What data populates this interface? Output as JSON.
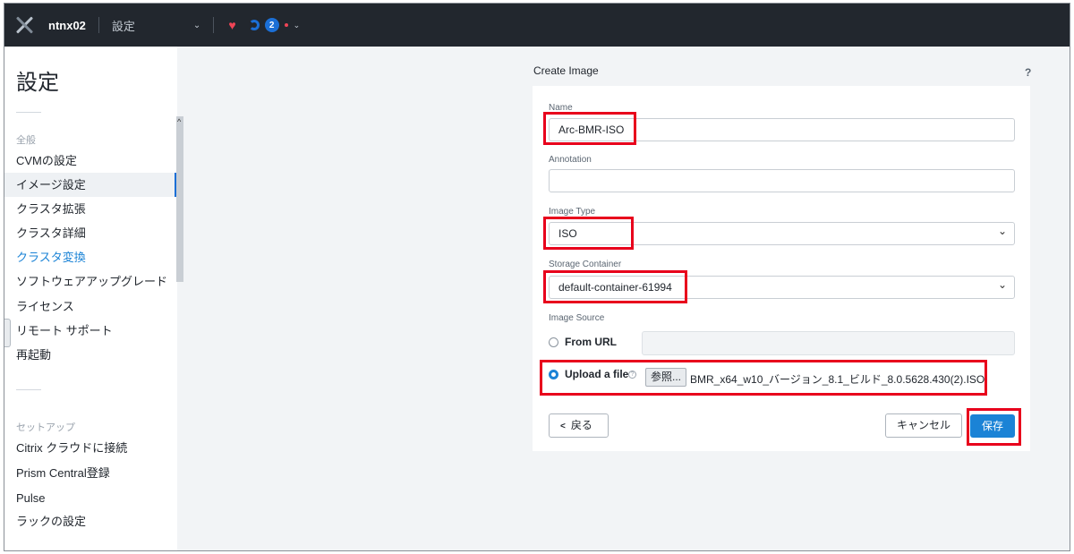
{
  "topbar": {
    "cluster_name": "ntnx02",
    "breadcrumb": "設定",
    "dropdown_icon": "chevron-down-icon",
    "notification_count": "2",
    "health_color": "#f04456",
    "accent_color": "#1b6fd6"
  },
  "sidebar": {
    "title": "設定",
    "section_general": "全般",
    "general_items": [
      {
        "label": "CVMの設定"
      },
      {
        "label": "イメージ設定"
      },
      {
        "label": "クラスタ拡張"
      },
      {
        "label": "クラスタ詳細"
      },
      {
        "label": "クラスタ変換"
      },
      {
        "label": "ソフトウェアアップグレード"
      },
      {
        "label": "ライセンス"
      },
      {
        "label": "リモート サポート"
      },
      {
        "label": "再起動"
      }
    ],
    "section_setup": "セットアップ",
    "setup_items": [
      {
        "label": "Citrix クラウドに接続"
      },
      {
        "label": "Prism Central登録"
      },
      {
        "label": "Pulse"
      },
      {
        "label": "ラックの設定"
      }
    ]
  },
  "dialog": {
    "title": "Create Image",
    "help": "?",
    "name_label": "Name",
    "name_value": "Arc-BMR-ISO",
    "annotation_label": "Annotation",
    "annotation_value": "",
    "image_type_label": "Image Type",
    "image_type_value": "ISO",
    "storage_label": "Storage Container",
    "storage_value": "default-container-61994",
    "source_label": "Image Source",
    "from_url_label": "From URL",
    "upload_label": "Upload a file",
    "upload_help": "?",
    "browse_label": "参照...",
    "file_name": "BMR_x64_w10_バージョン_8.1_ビルド_8.0.5628.430(2).ISO",
    "back_label": "戻る",
    "back_arrow": "<",
    "cancel_label": "キャンセル",
    "save_label": "保存",
    "highlight_color": "#e8001c"
  }
}
